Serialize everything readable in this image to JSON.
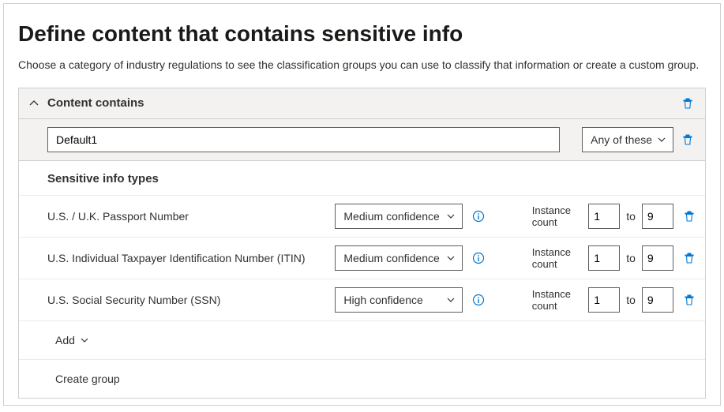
{
  "title": "Define content that contains sensitive info",
  "description": "Choose a category of industry regulations to see the classification groups you can use to classify that information or create a custom group.",
  "panel": {
    "title": "Content contains",
    "group_name": "Default1",
    "match_mode": "Any of these",
    "section_heading": "Sensitive info types",
    "instance_label": "Instance count",
    "to_label": "to",
    "rows": [
      {
        "label": "U.S. / U.K. Passport Number",
        "confidence": "Medium confidence",
        "from": "1",
        "to": "9"
      },
      {
        "label": "U.S. Individual Taxpayer Identification Number (ITIN)",
        "confidence": "Medium confidence",
        "from": "1",
        "to": "9"
      },
      {
        "label": "U.S. Social Security Number (SSN)",
        "confidence": "High confidence",
        "from": "1",
        "to": "9"
      }
    ],
    "add_label": "Add",
    "create_group_label": "Create group"
  }
}
